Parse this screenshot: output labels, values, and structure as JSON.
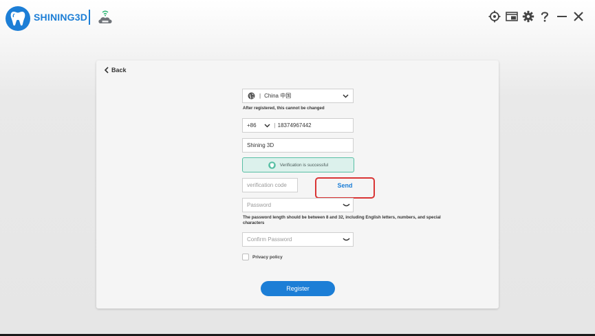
{
  "app": {
    "brand": "SHINING3D"
  },
  "titlebar_icons": [
    "crosshair-icon",
    "screenshot-icon",
    "gear-icon",
    "help-icon",
    "minimize-icon",
    "close-icon"
  ],
  "back_label": "Back",
  "form": {
    "region": {
      "value": "China 中国",
      "hint": "After registered, this cannot be changed"
    },
    "phone": {
      "country_code": "+86",
      "number": "18374967442"
    },
    "organization": {
      "value": "Shining 3D"
    },
    "verification_status": "Verification is successful",
    "code": {
      "placeholder": "verification code"
    },
    "send_label": "Send",
    "password": {
      "placeholder": "Password",
      "hint": "The password length should be between 8 and 32, including English letters, numbers, and special characters"
    },
    "confirm_password": {
      "placeholder": "Confirm Password"
    },
    "privacy_label": "Privacy policy",
    "register_label": "Register"
  },
  "colors": {
    "accent": "#1c7ed6",
    "highlight": "#d93434",
    "success_bg": "#dcf1ec",
    "success_border": "#57bfa4"
  }
}
